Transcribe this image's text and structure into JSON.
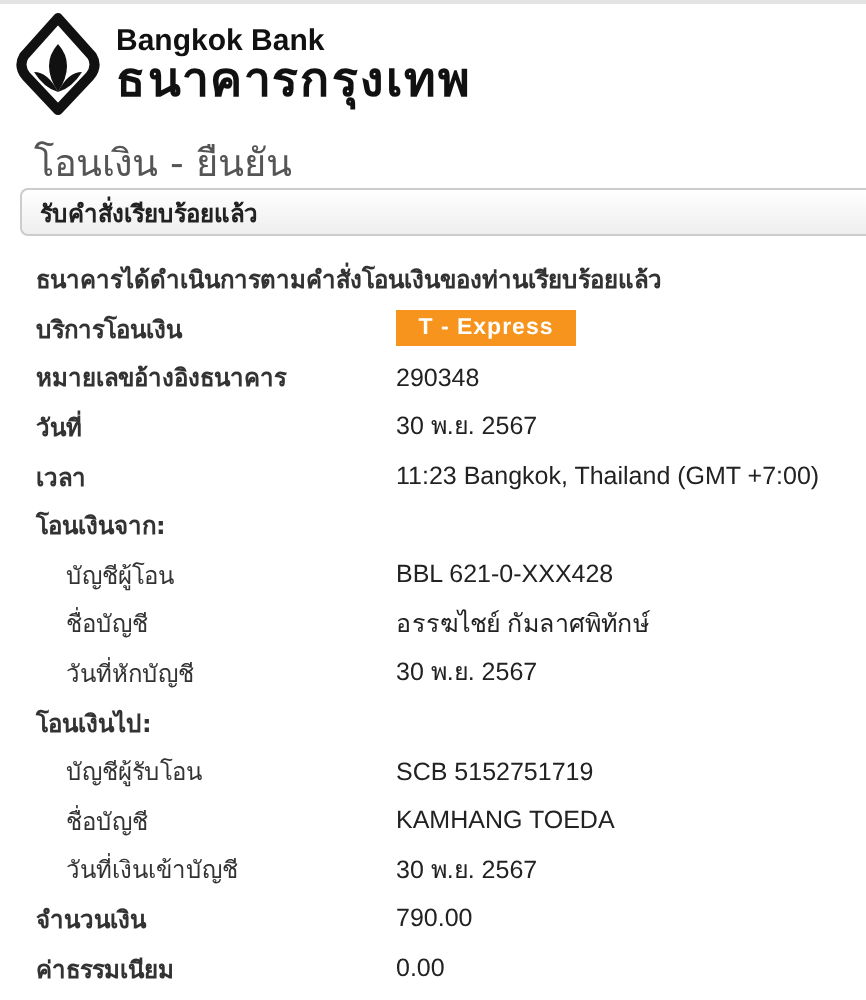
{
  "logo": {
    "name_en": "Bangkok Bank",
    "name_th": "ธนาคารกรุงเทพ"
  },
  "page_title": "โอนเงิน - ยืนยัน",
  "status_panel": {
    "text": "รับคำสั่งเรียบร้อยแล้ว"
  },
  "message": "ธนาคารได้ดำเนินการตามคำสั่งโอนเงินของท่านเรียบร้อยแล้ว",
  "details": [
    {
      "kind": "badge",
      "label": "บริการโอนเงิน",
      "value": "T - Express"
    },
    {
      "kind": "text",
      "label": "หมายเลขอ้างอิงธนาคาร",
      "value": "290348"
    },
    {
      "kind": "text",
      "label": "วันที่",
      "value": "30 พ.ย. 2567"
    },
    {
      "kind": "text",
      "label": "เวลา",
      "value": "11:23 Bangkok, Thailand (GMT +7:00)"
    },
    {
      "kind": "section",
      "label": "โอนเงินจาก:",
      "children": [
        {
          "kind": "text",
          "label": "บัญชีผู้โอน",
          "value": "BBL 621-0-XXX428"
        },
        {
          "kind": "text",
          "label": "ชื่อบัญชี",
          "value": "อรรฆไชย์ กัมลาศพิทักษ์"
        },
        {
          "kind": "text",
          "label": "วันที่หักบัญชี",
          "value": "30 พ.ย. 2567"
        }
      ]
    },
    {
      "kind": "section",
      "label": "โอนเงินไป:",
      "children": [
        {
          "kind": "text",
          "label": "บัญชีผู้รับโอน",
          "value": "SCB 5152751719"
        },
        {
          "kind": "text",
          "label": "ชื่อบัญชี",
          "value": "KAMHANG TOEDA"
        },
        {
          "kind": "text",
          "label": "วันที่เงินเข้าบัญชี",
          "value": "30 พ.ย. 2567"
        }
      ]
    },
    {
      "kind": "text",
      "label": "จำนวนเงิน",
      "value": "790.00"
    },
    {
      "kind": "text",
      "label": "ค่าธรรมเนียม",
      "value": "0.00"
    }
  ]
}
